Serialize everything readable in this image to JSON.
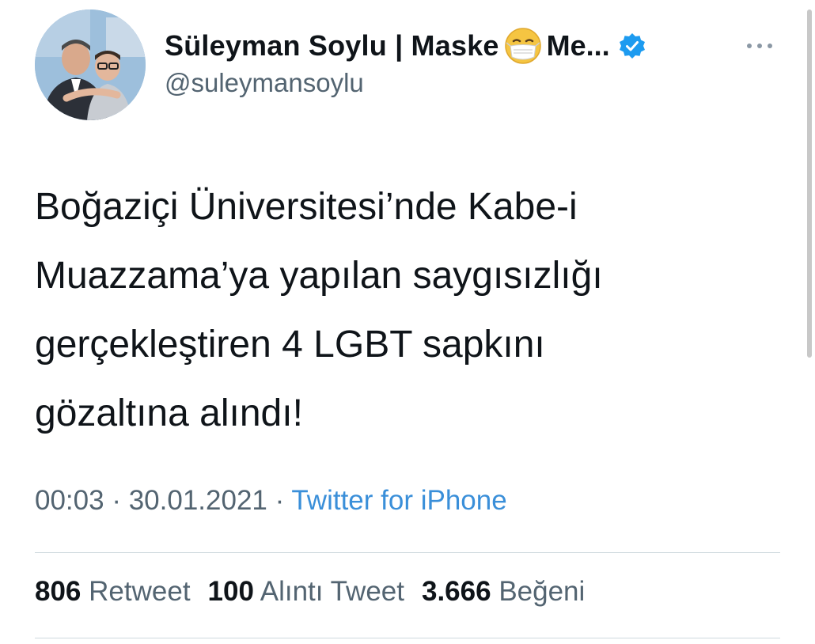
{
  "author": {
    "name_prefix": "Süleyman Soylu | Maske",
    "name_suffix": " Me...",
    "handle": "@suleymansoylu",
    "icons": {
      "emoji": "face-with-medical-mask-icon",
      "verified": "verified-badge-icon",
      "more": "more-options-icon"
    }
  },
  "tweet": {
    "lines": [
      "Boğaziçi Üniversitesi’nde Kabe-i",
      "Muazzama’ya yapılan saygısızlığı",
      "gerçekleştiren 4 LGBT sapkını",
      "gözaltına alındı!"
    ],
    "time": "00:03",
    "separator": " · ",
    "date": "30.01.2021",
    "source": "Twitter for iPhone"
  },
  "stats": {
    "retweet_count": "806",
    "retweet_label": "Retweet",
    "quote_count": "100",
    "quote_label": "Alıntı Tweet",
    "like_count": "3.666",
    "like_label": "Beğeni"
  },
  "colors": {
    "text": "#0f1419",
    "secondary": "#536471",
    "link": "#3a8fd9",
    "verified": "#1d9bf0",
    "divider": "#cfd9de"
  }
}
